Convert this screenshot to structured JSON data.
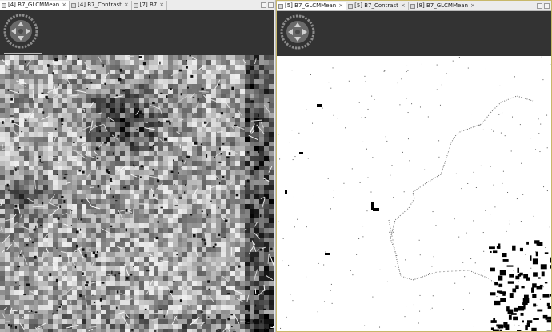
{
  "left_view": {
    "tabs": [
      {
        "label": "[4] B7_GLCMMean",
        "active": true
      },
      {
        "label": "[4] B7_Contrast",
        "active": false
      },
      {
        "label": "[7] B7",
        "active": false
      }
    ],
    "close_glyph": "×"
  },
  "right_view": {
    "tabs": [
      {
        "label": "[5] B7_GLCMMean",
        "active": true
      },
      {
        "label": "[5] B7_Contrast",
        "active": false
      },
      {
        "label": "[8] B7_GLCMMean",
        "active": false
      }
    ],
    "close_glyph": "×"
  },
  "icons": {
    "tab": "image-tab-icon",
    "navigation": "navigation-compass-icon",
    "scale": "scale-bar"
  },
  "colors": {
    "nav_panel": "#333333",
    "active_view_border": "#c8b86a",
    "tab_bar": "#ececec"
  }
}
